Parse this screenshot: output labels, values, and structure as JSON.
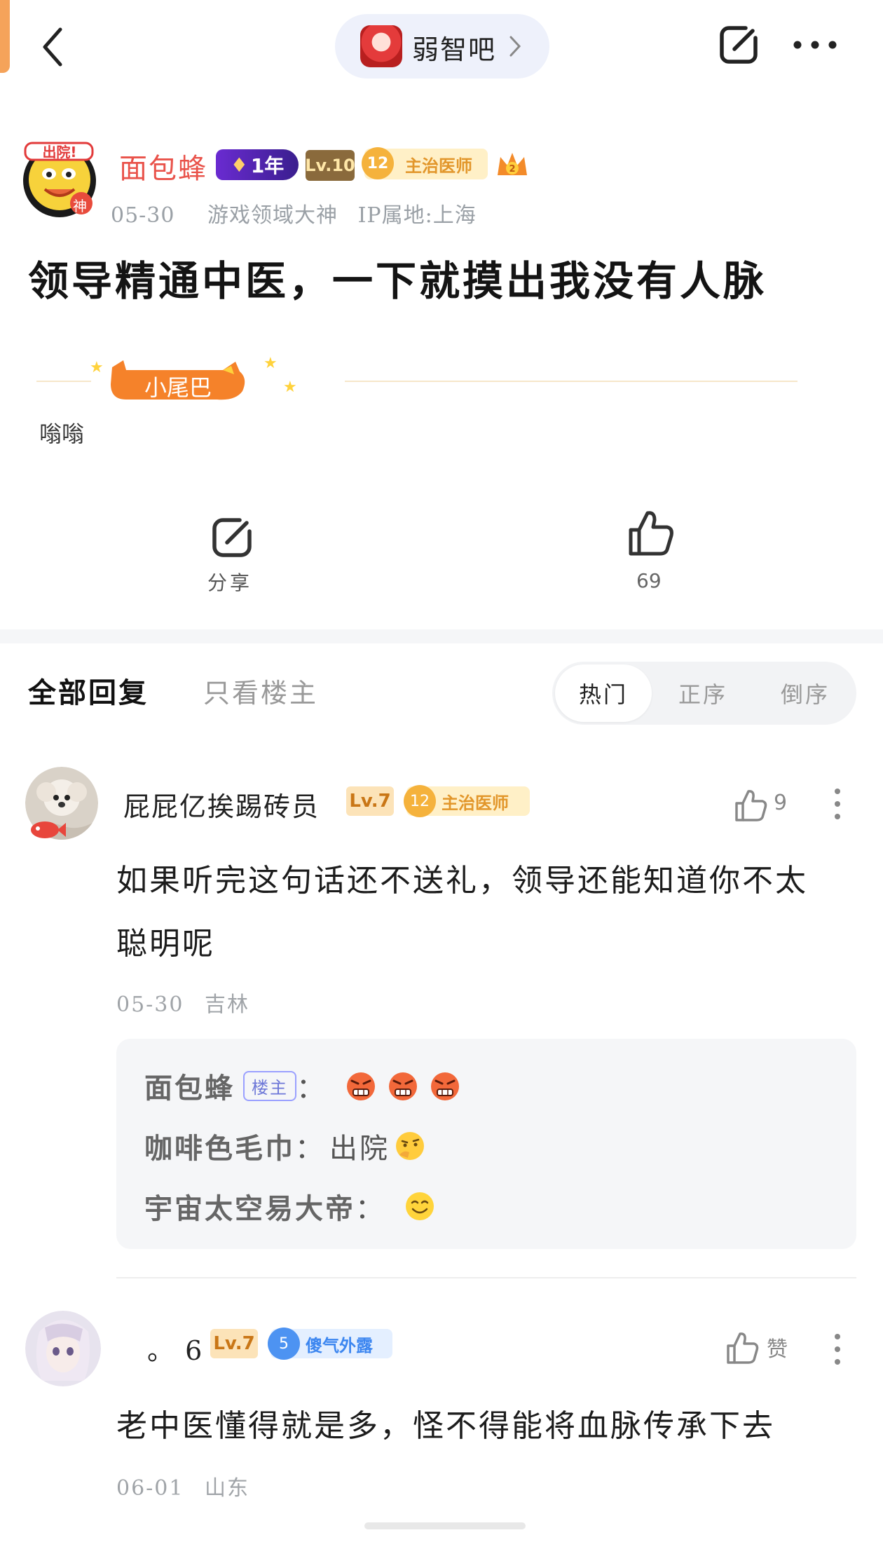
{
  "topbar": {
    "forum_name": "弱智吧"
  },
  "post": {
    "author": "面包蜂",
    "badges": {
      "year": "1年",
      "level": "Lv.10",
      "rank_num": "12",
      "rank_title": "主治医师",
      "avatar_tag": "神"
    },
    "date": "05-30",
    "identity": "游戏领域大神",
    "ip": "IP属地:上海",
    "title": "领导精通中医，一下就摸出我没有人脉",
    "tail_label": "小尾巴",
    "tail_text": "嗡嗡"
  },
  "actions": {
    "share_label": "分享",
    "like_count": "69"
  },
  "reply_tabs": {
    "all": "全部回复",
    "op_only": "只看楼主",
    "sort_hot": "热门",
    "sort_asc": "正序",
    "sort_desc": "倒序"
  },
  "comments": [
    {
      "name": "屁屁亿挨踢砖员",
      "level": "Lv.7",
      "rank_num": "12",
      "rank_title": "主治医师",
      "likes": "9",
      "text_line1": "如果听完这句话还不送礼，领导还能知道你不太",
      "text_line2": "聪明呢",
      "date": "05-30",
      "location": "吉林",
      "replies": [
        {
          "who": "面包蜂",
          "tag": "楼主",
          "sep": "：",
          "content": ""
        },
        {
          "who": "咖啡色毛巾",
          "sep": "：",
          "content": "出院"
        },
        {
          "who": "宇宙太空易大帝",
          "sep": "：",
          "content": ""
        }
      ]
    },
    {
      "name": "。 6",
      "level": "Lv.7",
      "rank_num": "5",
      "rank_title": "傻气外露",
      "likes": "赞",
      "text_line1": "老中医懂得就是多，怪不得能将血脉传承下去",
      "date": "06-01",
      "location": "山东"
    }
  ],
  "colors": {
    "author_red": "#e9524a",
    "level_gold": "#c97616",
    "rank_orange": "#e2962a",
    "rank_blue": "#3c86f0",
    "tail_orange": "#f5822a"
  },
  "icons": [
    "back-arrow-icon",
    "chevron-right-icon",
    "share-icon",
    "more-dots-icon",
    "thumbs-up-icon",
    "star-icon",
    "angry-face-emoji",
    "thinking-face-emoji",
    "smile-face-emoji"
  ]
}
